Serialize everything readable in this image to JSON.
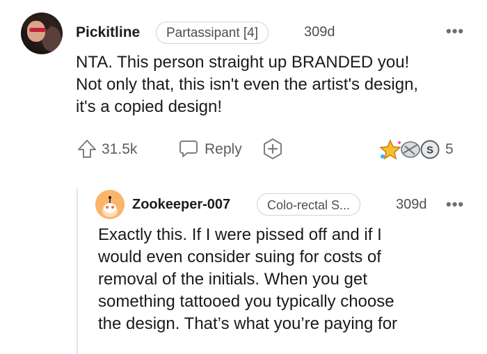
{
  "comment": {
    "username": "Pickitline",
    "flair": "Partassipant [4]",
    "age": "309d",
    "more_label": "•••",
    "lines": [
      "NTA. This person straight up BRANDED you!",
      "Not only that, this isn't even the artist's design,",
      "it's a copied design!"
    ],
    "upvotes": "31.5k",
    "reply_label": "Reply",
    "awards_count": "5"
  },
  "reply": {
    "username": "Zookeeper-007",
    "flair": "Colo-rectal S...",
    "age": "309d",
    "more_label": "•••",
    "lines": [
      "Exactly this. If I were pissed off and if I",
      "would even consider suing for costs of",
      "removal of the initials. When you get",
      "something tattooed you typically choose",
      "the design. That’s what you’re paying for"
    ]
  },
  "colors": {
    "text": "#1a1a1b",
    "muted": "#5a5e62",
    "reply_avatar": "#fbb56b",
    "thread_line": "#e3e5e6"
  }
}
